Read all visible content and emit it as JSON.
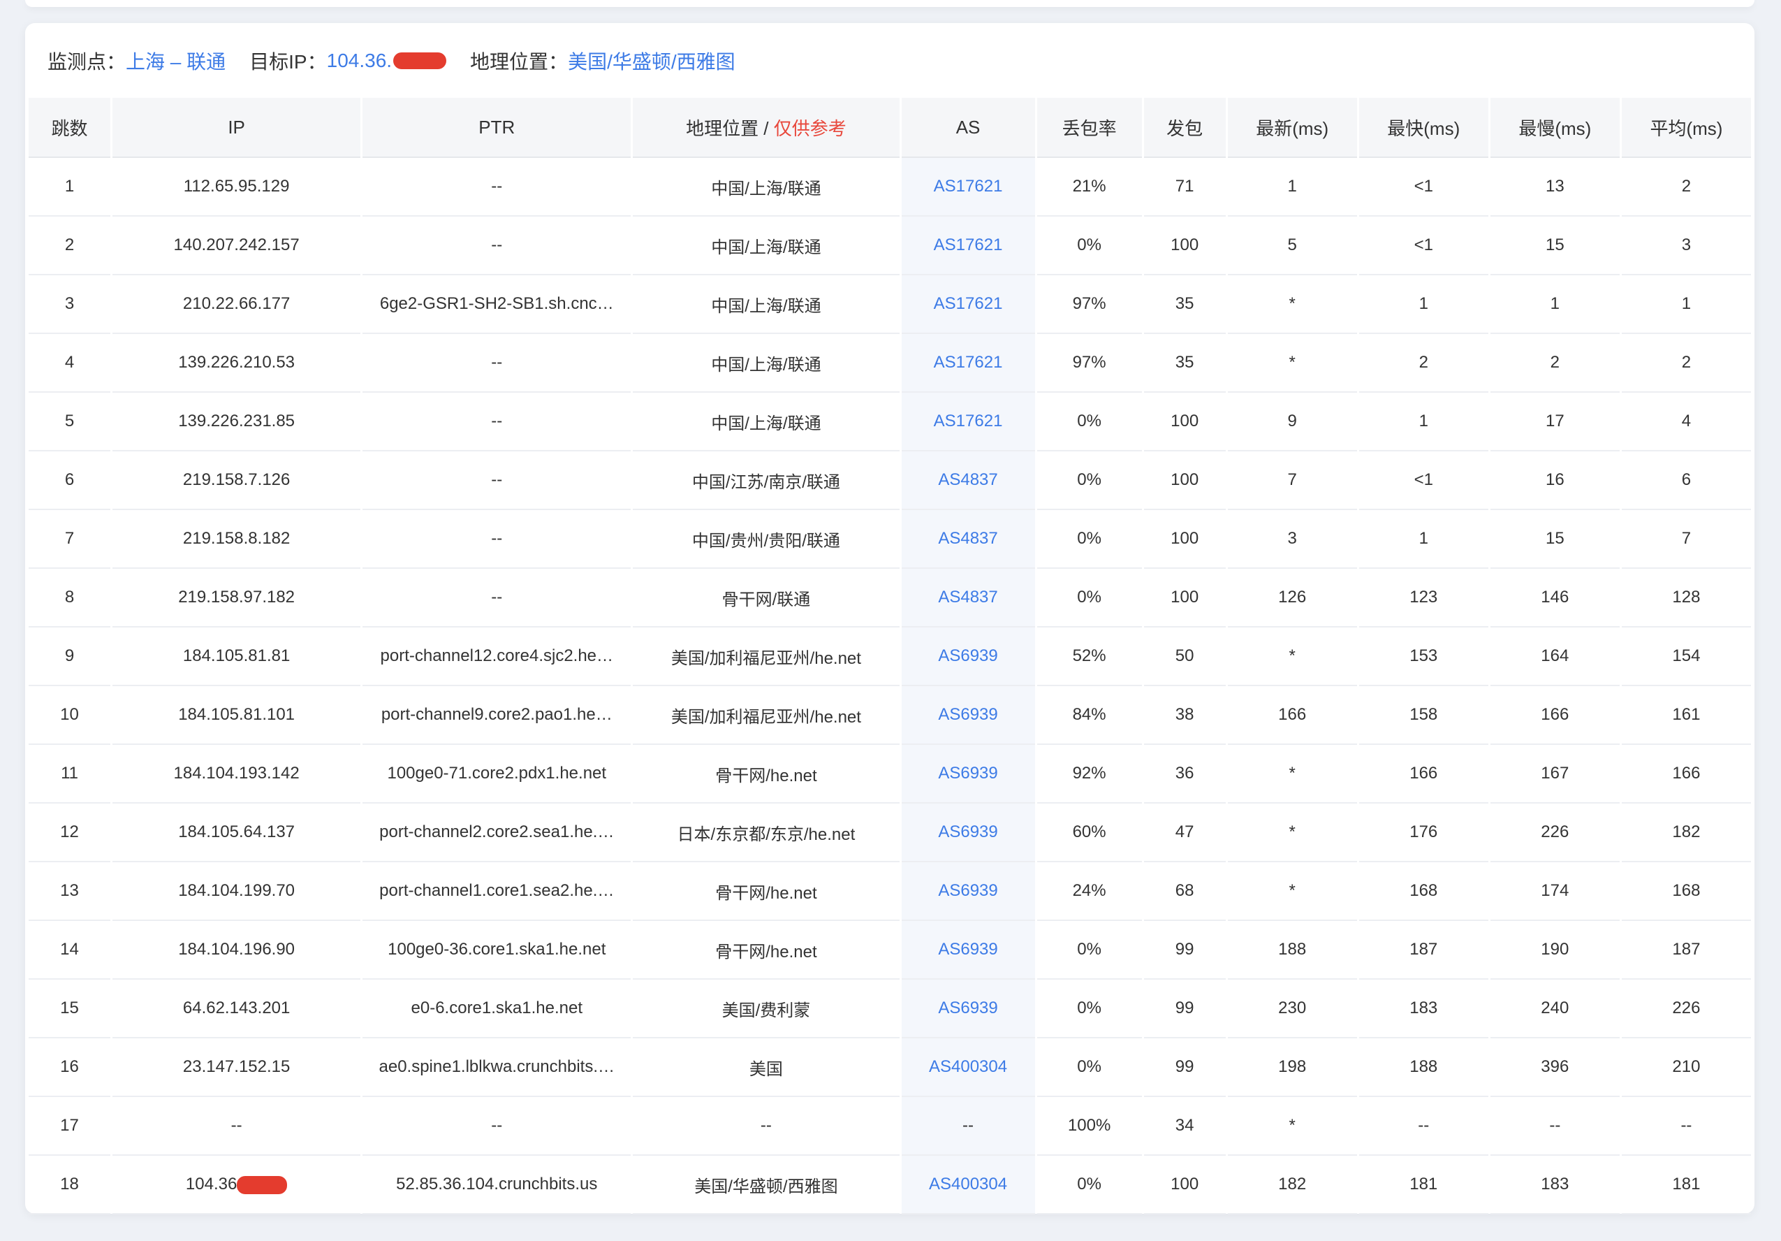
{
  "info": {
    "probe_label": "监测点：",
    "probe_value": "上海 – 联通",
    "target_label": "目标IP：",
    "target_value": "104.36.",
    "geo_label": "地理位置：",
    "geo_value": "美国/华盛顿/西雅图"
  },
  "colors": {
    "link": "#3d7be6",
    "warning": "#e8473b",
    "redaction": "#e43c2e",
    "background": "#eef1f6"
  },
  "table": {
    "headers": {
      "hop": "跳数",
      "ip": "IP",
      "ptr": "PTR",
      "geo": "地理位置",
      "geo_sep": " / ",
      "geo_note": "仅供参考",
      "as": "AS",
      "loss": "丢包率",
      "sent": "发包",
      "last": "最新(ms)",
      "best": "最快(ms)",
      "worst": "最慢(ms)",
      "avg": "平均(ms)"
    },
    "rows": [
      {
        "hop": "1",
        "ip": "112.65.95.129",
        "ptr": "--",
        "geo": "中国/上海/联通",
        "as": "AS17621",
        "loss": "21%",
        "sent": "71",
        "last": "1",
        "best": "<1",
        "worst": "13",
        "avg": "2"
      },
      {
        "hop": "2",
        "ip": "140.207.242.157",
        "ptr": "--",
        "geo": "中国/上海/联通",
        "as": "AS17621",
        "loss": "0%",
        "sent": "100",
        "last": "5",
        "best": "<1",
        "worst": "15",
        "avg": "3"
      },
      {
        "hop": "3",
        "ip": "210.22.66.177",
        "ptr": "6ge2-GSR1-SH2-SB1.sh.cnc…",
        "geo": "中国/上海/联通",
        "as": "AS17621",
        "loss": "97%",
        "sent": "35",
        "last": "*",
        "best": "1",
        "worst": "1",
        "avg": "1"
      },
      {
        "hop": "4",
        "ip": "139.226.210.53",
        "ptr": "--",
        "geo": "中国/上海/联通",
        "as": "AS17621",
        "loss": "97%",
        "sent": "35",
        "last": "*",
        "best": "2",
        "worst": "2",
        "avg": "2"
      },
      {
        "hop": "5",
        "ip": "139.226.231.85",
        "ptr": "--",
        "geo": "中国/上海/联通",
        "as": "AS17621",
        "loss": "0%",
        "sent": "100",
        "last": "9",
        "best": "1",
        "worst": "17",
        "avg": "4"
      },
      {
        "hop": "6",
        "ip": "219.158.7.126",
        "ptr": "--",
        "geo": "中国/江苏/南京/联通",
        "as": "AS4837",
        "loss": "0%",
        "sent": "100",
        "last": "7",
        "best": "<1",
        "worst": "16",
        "avg": "6"
      },
      {
        "hop": "7",
        "ip": "219.158.8.182",
        "ptr": "--",
        "geo": "中国/贵州/贵阳/联通",
        "as": "AS4837",
        "loss": "0%",
        "sent": "100",
        "last": "3",
        "best": "1",
        "worst": "15",
        "avg": "7"
      },
      {
        "hop": "8",
        "ip": "219.158.97.182",
        "ptr": "--",
        "geo": "骨干网/联通",
        "as": "AS4837",
        "loss": "0%",
        "sent": "100",
        "last": "126",
        "best": "123",
        "worst": "146",
        "avg": "128"
      },
      {
        "hop": "9",
        "ip": "184.105.81.81",
        "ptr": "port-channel12.core4.sjc2.he…",
        "geo": "美国/加利福尼亚州/he.net",
        "as": "AS6939",
        "loss": "52%",
        "sent": "50",
        "last": "*",
        "best": "153",
        "worst": "164",
        "avg": "154"
      },
      {
        "hop": "10",
        "ip": "184.105.81.101",
        "ptr": "port-channel9.core2.pao1.he…",
        "geo": "美国/加利福尼亚州/he.net",
        "as": "AS6939",
        "loss": "84%",
        "sent": "38",
        "last": "166",
        "best": "158",
        "worst": "166",
        "avg": "161"
      },
      {
        "hop": "11",
        "ip": "184.104.193.142",
        "ptr": "100ge0-71.core2.pdx1.he.net",
        "geo": "骨干网/he.net",
        "as": "AS6939",
        "loss": "92%",
        "sent": "36",
        "last": "*",
        "best": "166",
        "worst": "167",
        "avg": "166"
      },
      {
        "hop": "12",
        "ip": "184.105.64.137",
        "ptr": "port-channel2.core2.sea1.he.…",
        "geo": "日本/东京都/东京/he.net",
        "as": "AS6939",
        "loss": "60%",
        "sent": "47",
        "last": "*",
        "best": "176",
        "worst": "226",
        "avg": "182"
      },
      {
        "hop": "13",
        "ip": "184.104.199.70",
        "ptr": "port-channel1.core1.sea2.he.…",
        "geo": "骨干网/he.net",
        "as": "AS6939",
        "loss": "24%",
        "sent": "68",
        "last": "*",
        "best": "168",
        "worst": "174",
        "avg": "168"
      },
      {
        "hop": "14",
        "ip": "184.104.196.90",
        "ptr": "100ge0-36.core1.ska1.he.net",
        "geo": "骨干网/he.net",
        "as": "AS6939",
        "loss": "0%",
        "sent": "99",
        "last": "188",
        "best": "187",
        "worst": "190",
        "avg": "187"
      },
      {
        "hop": "15",
        "ip": "64.62.143.201",
        "ptr": "e0-6.core1.ska1.he.net",
        "geo": "美国/费利蒙",
        "as": "AS6939",
        "loss": "0%",
        "sent": "99",
        "last": "230",
        "best": "183",
        "worst": "240",
        "avg": "226"
      },
      {
        "hop": "16",
        "ip": "23.147.152.15",
        "ptr": "ae0.spine1.lblkwa.crunchbits.…",
        "geo": "美国",
        "as": "AS400304",
        "loss": "0%",
        "sent": "99",
        "last": "198",
        "best": "188",
        "worst": "396",
        "avg": "210"
      },
      {
        "hop": "17",
        "ip": "--",
        "ptr": "--",
        "geo": "--",
        "as": "--",
        "loss": "100%",
        "sent": "34",
        "last": "*",
        "best": "--",
        "worst": "--",
        "avg": "--"
      },
      {
        "hop": "18",
        "ip": "104.36",
        "ptr": "52.85.36.104.crunchbits.us",
        "geo": "美国/华盛顿/西雅图",
        "as": "AS400304",
        "loss": "0%",
        "sent": "100",
        "last": "182",
        "best": "181",
        "worst": "183",
        "avg": "181",
        "ip_redacted": true
      }
    ]
  }
}
